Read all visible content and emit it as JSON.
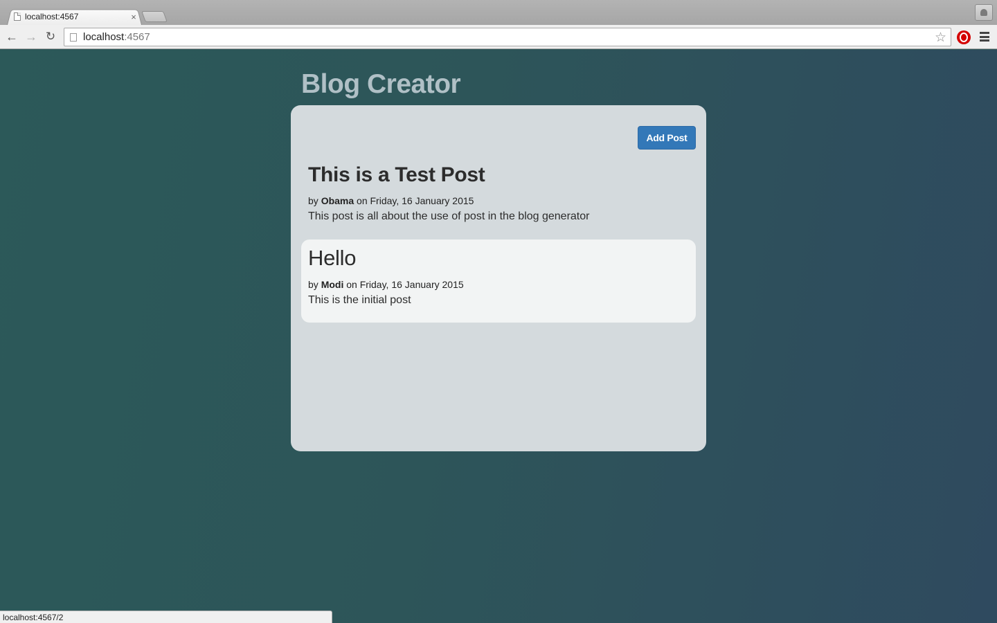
{
  "browser": {
    "tab_title": "localhost:4567",
    "tab_close": "×",
    "url_host": "localhost",
    "url_port": ":4567",
    "status_url": "localhost:4567/2",
    "icons": {
      "back": "back-arrow-icon",
      "forward": "forward-arrow-icon",
      "reload": "reload-icon",
      "star": "bookmark-star-icon",
      "extension": "adblock-icon",
      "menu": "menu-icon",
      "profile": "profile-icon"
    },
    "colors": {
      "extension": "#d40000"
    }
  },
  "site": {
    "title": "Blog Creator",
    "add_post_label": "Add Post",
    "accent": "#3378b8"
  },
  "posts": [
    {
      "title": "This is a Test Post",
      "by": "by",
      "author": "Obama",
      "date_text": "on Friday, 16 January 2015",
      "body": "This post is all about the use of post in the blog generator"
    },
    {
      "title": "Hello",
      "by": "by",
      "author": "Modi",
      "date_text": "on Friday, 16 January 2015",
      "body": "This is the initial post"
    }
  ]
}
